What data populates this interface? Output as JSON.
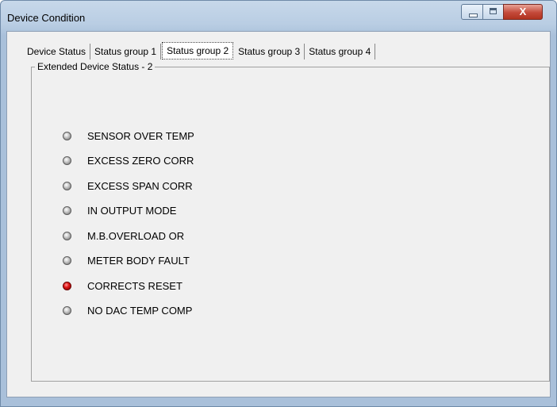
{
  "window": {
    "title": "Device Condition",
    "close_glyph": "X"
  },
  "tabs": [
    {
      "label": "Device Status",
      "active": false
    },
    {
      "label": "Status group 1",
      "active": false
    },
    {
      "label": "Status group 2",
      "active": true
    },
    {
      "label": "Status group 3",
      "active": false
    },
    {
      "label": "Status group 4",
      "active": false
    }
  ],
  "group": {
    "title": "Extended Device Status - 2"
  },
  "status_items": [
    {
      "label": "SENSOR OVER TEMP",
      "state": "off"
    },
    {
      "label": "EXCESS ZERO CORR",
      "state": "off"
    },
    {
      "label": "EXCESS SPAN CORR",
      "state": "off"
    },
    {
      "label": "IN OUTPUT MODE",
      "state": "off"
    },
    {
      "label": "M.B.OVERLOAD OR",
      "state": "off"
    },
    {
      "label": "METER BODY FAULT",
      "state": "off"
    },
    {
      "label": "CORRECTS RESET",
      "state": "on"
    },
    {
      "label": "NO DAC TEMP COMP",
      "state": "off"
    }
  ],
  "colors": {
    "led_on": "#e01818",
    "led_off": "#b0b0b0"
  }
}
